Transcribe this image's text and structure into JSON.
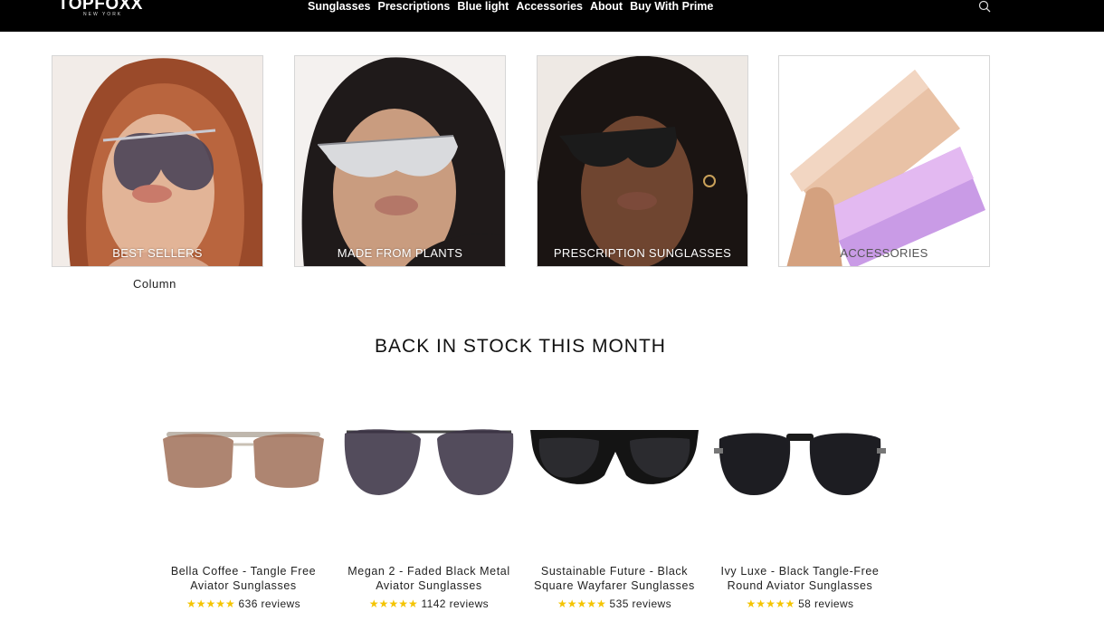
{
  "header": {
    "logo_text": "TOPFOXX",
    "logo_sub": "NEW YORK",
    "nav": [
      "Sunglasses",
      "Prescriptions",
      "Blue light",
      "Accessories",
      "About",
      "Buy With Prime"
    ],
    "search_icon": "search-icon"
  },
  "categories": [
    {
      "label": "BEST SELLERS"
    },
    {
      "label": "MADE FROM PLANTS"
    },
    {
      "label": "PRESCRIPTION SUNGLASSES"
    },
    {
      "label": "ACCESSORIES"
    }
  ],
  "column_caption": "Column",
  "section_title": "BACK IN STOCK THIS MONTH",
  "products": [
    {
      "title_line1": "Bella Coffee - Tangle Free",
      "title_line2": "Aviator Sunglasses",
      "stars": "★★★★★",
      "reviews": "636 reviews"
    },
    {
      "title_line1": "Megan 2 - Faded Black Metal",
      "title_line2": "Aviator Sunglasses",
      "stars": "★★★★★",
      "reviews": "1142 reviews"
    },
    {
      "title_line1": "Sustainable Future - Black",
      "title_line2": "Square Wayfarer Sunglasses",
      "stars": "★★★★★",
      "reviews": "535 reviews"
    },
    {
      "title_line1": "Ivy Luxe - Black Tangle-Free",
      "title_line2": "Round Aviator Sunglasses",
      "stars": "★★★★★",
      "reviews": "58 reviews"
    }
  ],
  "colors": {
    "header_bg": "#000000",
    "star": "#f4c400"
  }
}
